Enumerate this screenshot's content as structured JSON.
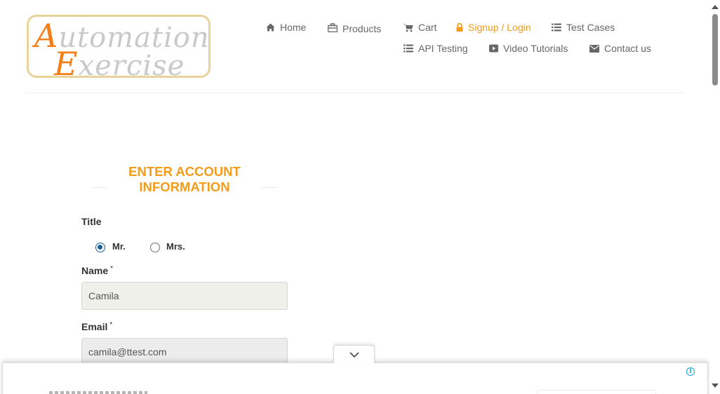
{
  "logo": {
    "line1_cap": "A",
    "line1_rest": "utomation",
    "line2_cap": "E",
    "line2_rest": "xercise"
  },
  "nav": {
    "home": "Home",
    "products": "Products",
    "cart": "Cart",
    "signup_login": "Signup / Login",
    "test_cases": "Test Cases",
    "api_testing": "API Testing",
    "video_tutorials": "Video Tutorials",
    "contact_us": "Contact us"
  },
  "form": {
    "heading": "Enter Account Information",
    "title_label": "Title",
    "title_options": [
      "Mr.",
      "Mrs."
    ],
    "title_selected": "Mr.",
    "name_label": "Name",
    "name_value": "Camila",
    "email_label": "Email",
    "email_value": "camila@ttest.com",
    "required_mark": "*"
  },
  "ad": {
    "info_symbol": "i"
  },
  "colors": {
    "accent": "#f49b18",
    "logo_orange": "#f57f17",
    "nav_text": "#696763",
    "radio_blue": "#1a5fa0"
  }
}
